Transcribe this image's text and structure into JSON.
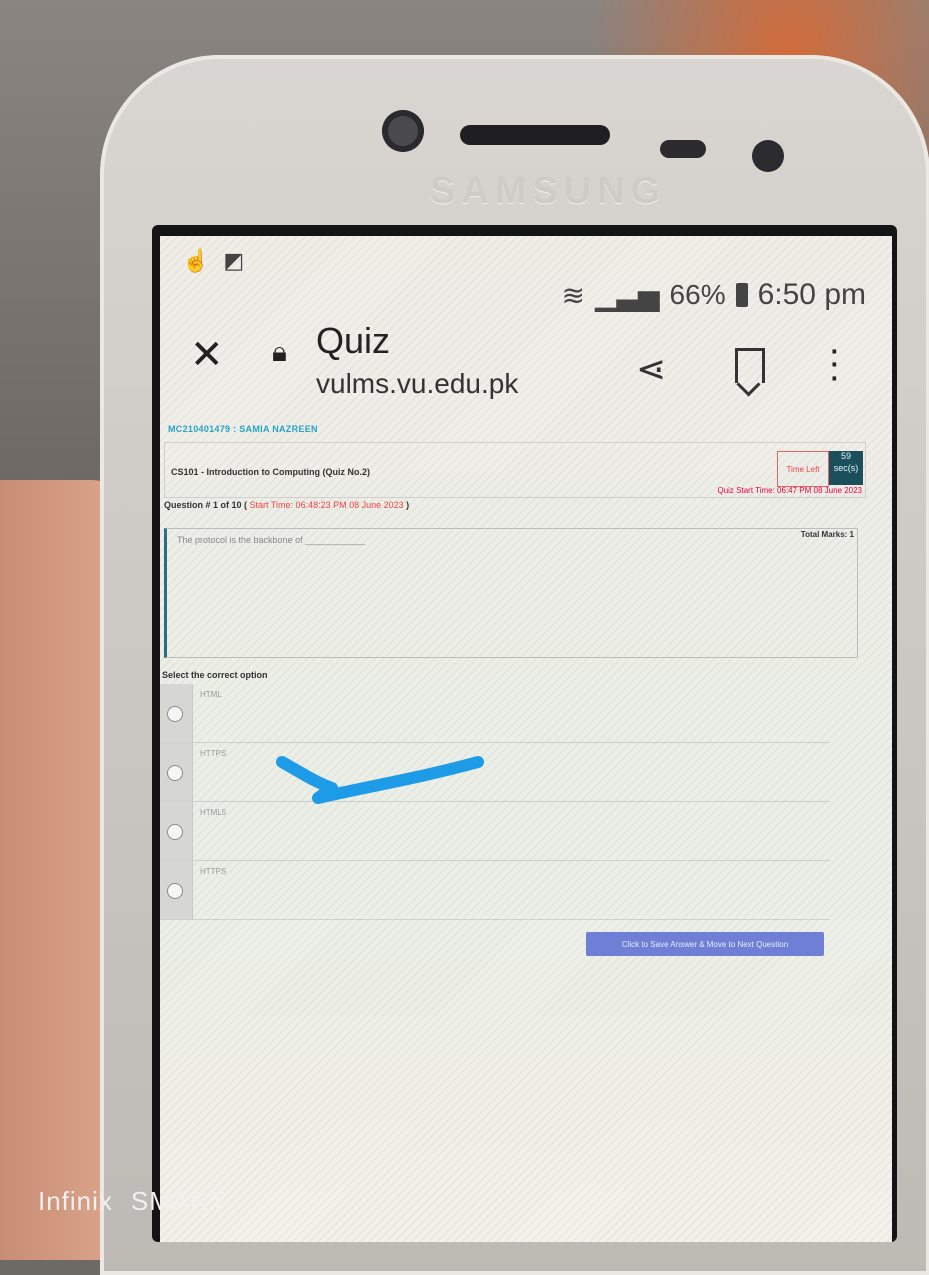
{
  "device": {
    "brand": "SAMSUNG",
    "watermark_brand": "Infinix",
    "watermark_model": "SMART"
  },
  "status_bar": {
    "battery": "66%",
    "time": "6:50 pm"
  },
  "browser": {
    "title": "Quiz",
    "url": "vulms.vu.edu.pk"
  },
  "quiz": {
    "student": "MC210401479 : SAMIA NAZREEN",
    "course": "CS101 - Introduction to Computing (Quiz No.2)",
    "time_left_label": "Time Left",
    "seconds_left": "59",
    "seconds_unit": "sec(s)",
    "quiz_start": "Quiz Start Time: 06:47 PM 08 June 2023",
    "question_number": "Question # 1 of 10 (",
    "start_time": "Start Time: 06:48:23 PM 08 June 2023",
    "question_close": ")",
    "total_marks": "Total Marks: 1",
    "question_text": "The protocol is the backbone of ____________",
    "select_label": "Select the correct option",
    "options": [
      "HTML",
      "HTTPS",
      "HTML5",
      "HTTPS"
    ],
    "next_button": "Click to Save Answer & Move to Next Question"
  }
}
